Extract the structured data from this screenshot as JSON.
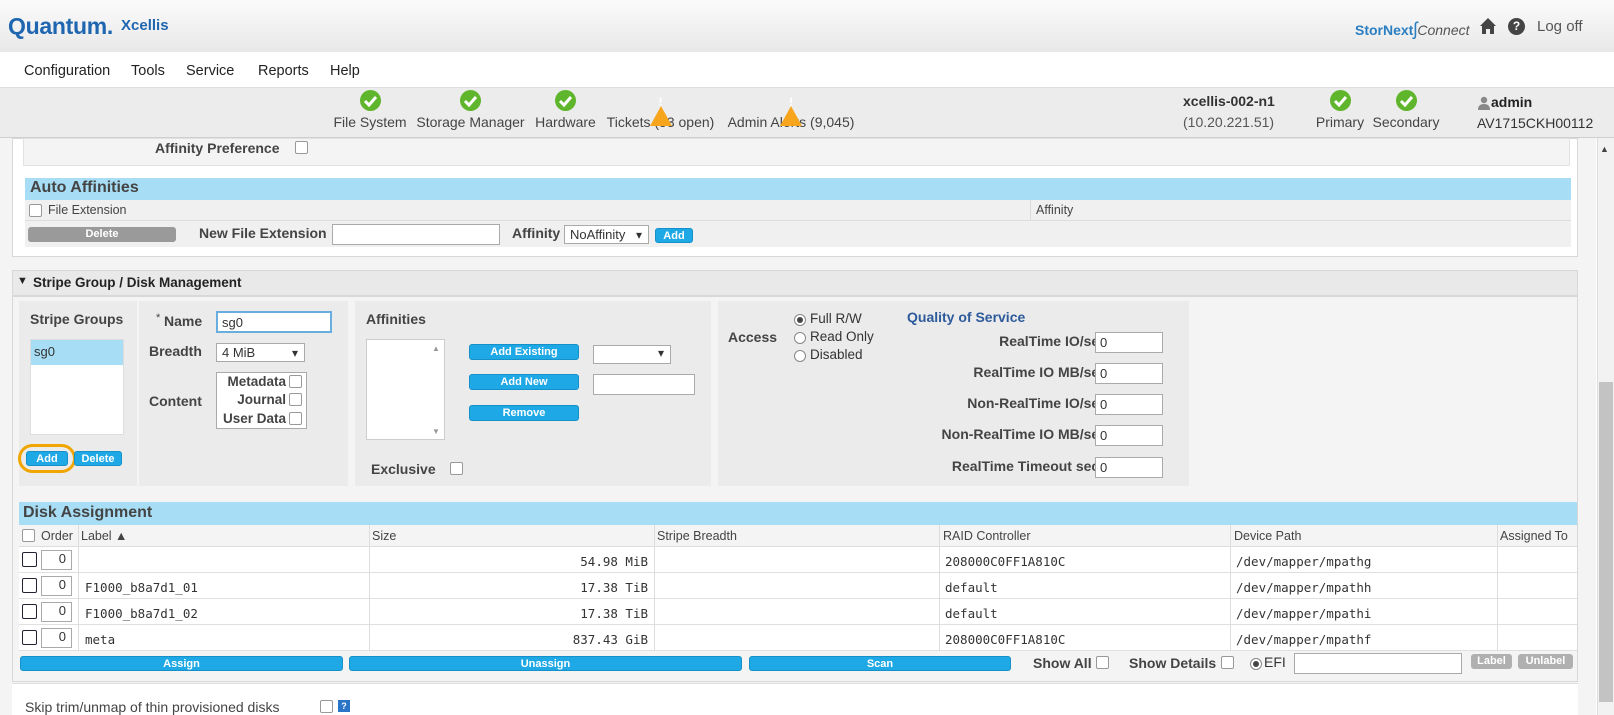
{
  "app": {
    "brand": "Quantum.",
    "product": "Xcellis",
    "stornext_a": "StorNext",
    "stornext_b": "Connect",
    "logoff": "Log off",
    "help": "?"
  },
  "menu": [
    "Configuration",
    "Tools",
    "Service",
    "Reports",
    "Help"
  ],
  "status": [
    {
      "label": "File System",
      "state": "ok"
    },
    {
      "label": "Storage Manager",
      "state": "ok"
    },
    {
      "label": "Hardware",
      "state": "ok"
    },
    {
      "label": "Tickets (53 open)",
      "state": "warn"
    },
    {
      "label": "Admin Alerts (9,045)",
      "state": "warn"
    }
  ],
  "node": {
    "name": "xcellis-002-n1",
    "ip": "(10.20.221.51)",
    "primary": "Primary",
    "secondary": "Secondary",
    "user": "admin",
    "serial": "AV1715CKH00112"
  },
  "affinity_pref": {
    "label": "Affinity Preference"
  },
  "auto_affinities": {
    "title": "Auto Affinities",
    "col_ext": "File Extension",
    "col_aff": "Affinity",
    "delete": "Delete",
    "new_ext_label": "New File Extension",
    "new_ext_value": "",
    "affinity_label": "Affinity",
    "affinity_value": "NoAffinity",
    "add": "Add"
  },
  "sg": {
    "section_title": "Stripe Group / Disk Management",
    "groups_label": "Stripe Groups",
    "groups": [
      "sg0"
    ],
    "add": "Add",
    "delete": "Delete",
    "name_req": "*",
    "name_label": "Name",
    "name_value": "sg0",
    "breadth_label": "Breadth",
    "breadth_value": "4 MiB",
    "content_label": "Content",
    "content_opts": [
      "Metadata",
      "Journal",
      "User Data"
    ],
    "affinities_label": "Affinities",
    "add_existing": "Add Existing",
    "add_new": "Add New",
    "remove": "Remove",
    "exclusive": "Exclusive",
    "access_label": "Access",
    "access_opts": [
      "Full R/W",
      "Read Only",
      "Disabled"
    ],
    "access_selected": 0,
    "qos_title": "Quality of Service",
    "qos": [
      {
        "label": "RealTime IO/sec",
        "value": "0"
      },
      {
        "label": "RealTime IO MB/sec",
        "value": "0"
      },
      {
        "label": "Non-RealTime IO/sec",
        "value": "0"
      },
      {
        "label": "Non-RealTime IO MB/sec",
        "value": "0"
      },
      {
        "label": "RealTime Timeout secs",
        "value": "0"
      }
    ]
  },
  "disks": {
    "title": "Disk Assignment",
    "cols": {
      "order": "Order",
      "label": "Label ▲",
      "size": "Size",
      "stripe": "Stripe Breadth",
      "raid": "RAID Controller",
      "path": "Device Path",
      "assigned": "Assigned To"
    },
    "rows": [
      {
        "order": "0",
        "label": "",
        "size": "54.98 MiB",
        "stripe": "",
        "raid": "208000C0FF1A810C",
        "path": "/dev/mapper/mpathg",
        "assigned": ""
      },
      {
        "order": "0",
        "label": "F1000_b8a7d1_01",
        "size": "17.38 TiB",
        "stripe": "",
        "raid": "default",
        "path": "/dev/mapper/mpathh",
        "assigned": ""
      },
      {
        "order": "0",
        "label": "F1000_b8a7d1_02",
        "size": "17.38 TiB",
        "stripe": "",
        "raid": "default",
        "path": "/dev/mapper/mpathi",
        "assigned": ""
      },
      {
        "order": "0",
        "label": "meta",
        "size": "837.43 GiB",
        "stripe": "",
        "raid": "208000C0FF1A810C",
        "path": "/dev/mapper/mpathf",
        "assigned": ""
      }
    ],
    "assign": "Assign",
    "unassign": "Unassign",
    "scan": "Scan",
    "show_all": "Show All",
    "show_details": "Show Details",
    "efi": "EFI",
    "efi_value": "",
    "label_btn": "Label",
    "unlabel_btn": "Unlabel"
  },
  "skip_trim": {
    "label": "Skip trim/unmap of thin provisioned disks",
    "help": "?"
  },
  "colors": {
    "brand": "#1f66b1",
    "accent": "#1fa8e6",
    "ok": "#5fb52b",
    "warn": "#f6a51c",
    "header_bar": "#a7ddf5",
    "highlight_ring": "#f0a500"
  }
}
